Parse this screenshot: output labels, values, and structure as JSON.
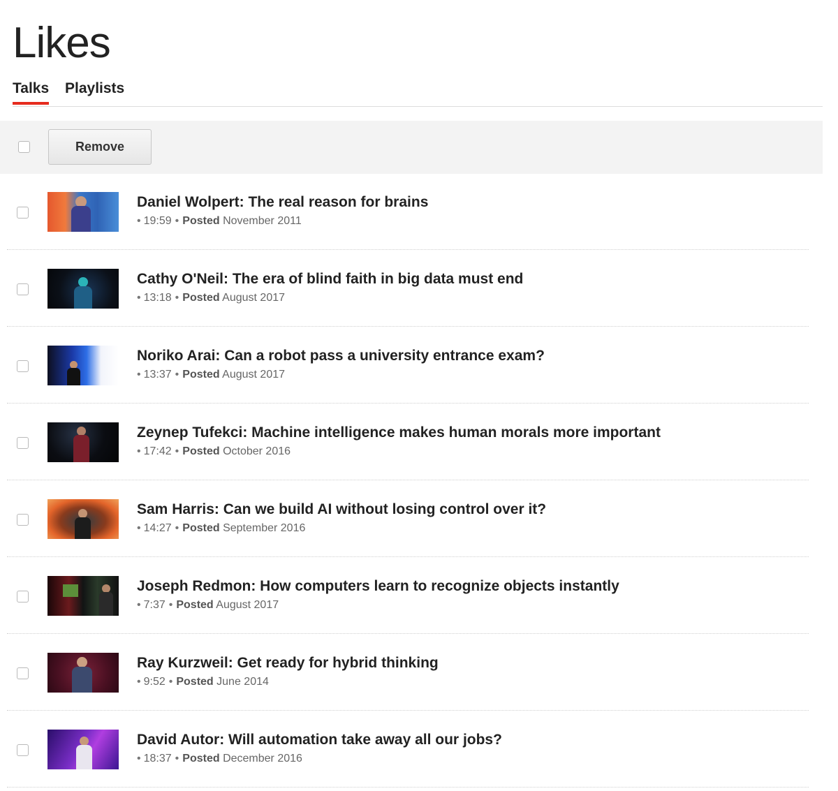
{
  "page": {
    "title": "Likes"
  },
  "tabs": [
    {
      "label": "Talks",
      "active": true
    },
    {
      "label": "Playlists",
      "active": false
    }
  ],
  "toolbar": {
    "remove_label": "Remove"
  },
  "meta_labels": {
    "bullet": "•",
    "posted": "Posted"
  },
  "colors": {
    "accent": "#e62b1e",
    "toolbar_background": "#f3f3f3"
  },
  "talks": [
    {
      "title": "Daniel Wolpert: The real reason for brains",
      "duration": "19:59",
      "posted": "November 2011"
    },
    {
      "title": "Cathy O'Neil: The era of blind faith in big data must end",
      "duration": "13:18",
      "posted": "August 2017"
    },
    {
      "title": "Noriko Arai: Can a robot pass a university entrance exam?",
      "duration": "13:37",
      "posted": "August 2017"
    },
    {
      "title": "Zeynep Tufekci: Machine intelligence makes human morals more important",
      "duration": "17:42",
      "posted": "October 2016"
    },
    {
      "title": "Sam Harris: Can we build AI without losing control over it?",
      "duration": "14:27",
      "posted": "September 2016"
    },
    {
      "title": "Joseph Redmon: How computers learn to recognize objects instantly",
      "duration": "7:37",
      "posted": "August 2017"
    },
    {
      "title": "Ray Kurzweil: Get ready for hybrid thinking",
      "duration": "9:52",
      "posted": "June 2014"
    },
    {
      "title": "David Autor: Will automation take away all our jobs?",
      "duration": "18:37",
      "posted": "December 2016"
    }
  ]
}
